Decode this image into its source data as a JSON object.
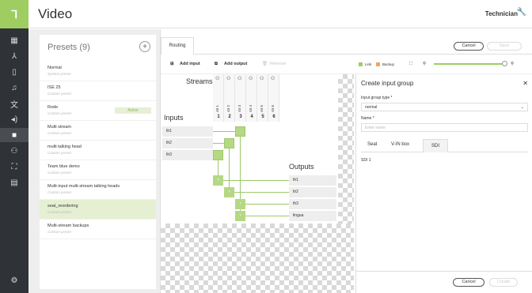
{
  "app": {
    "title": "Video",
    "user": "Technician"
  },
  "nav_icons": [
    "apps-icon",
    "network-icon",
    "device-icon",
    "audio-icon",
    "translate-icon",
    "speaker-icon",
    "video-icon",
    "users-icon",
    "seat-icon",
    "document-icon"
  ],
  "presets": {
    "title": "Presets (9)",
    "items": [
      {
        "name": "Normal",
        "sub": "System preset",
        "active": false
      },
      {
        "name": "ISE 25",
        "sub": "Custom preset",
        "active": false
      },
      {
        "name": "Rode",
        "sub": "Custom preset",
        "active": true,
        "badge": "Active"
      },
      {
        "name": "Multi stream",
        "sub": "Custom preset",
        "active": false
      },
      {
        "name": "multi talking head",
        "sub": "Custom preset",
        "active": false
      },
      {
        "name": "Team blue demo",
        "sub": "Custom preset",
        "active": false
      },
      {
        "name": "Multi-input multi-stream talking heads",
        "sub": "Custom preset",
        "active": false
      },
      {
        "name": "seat_reordering",
        "sub": "Custom preset",
        "active": false
      },
      {
        "name": "Multi-stream backups",
        "sub": "Custom preset",
        "active": false
      }
    ]
  },
  "routing": {
    "tab": "Routing",
    "cancel": "Cancel",
    "save": "Save",
    "toolbar": {
      "add_input": "Add input",
      "add_output": "Add output",
      "remove": "Remove",
      "link": "Link",
      "backup": "Backup"
    },
    "link_color": "#9fcd62",
    "backup_color": "#f2a65a",
    "streams_label": "Streams",
    "inputs_label": "Inputs",
    "outputs_label": "Outputs",
    "streams": [
      {
        "num": "1",
        "label": "str 1"
      },
      {
        "num": "2",
        "label": "str 2"
      },
      {
        "num": "3",
        "label": "str 3"
      },
      {
        "num": "4",
        "label": "str 4"
      },
      {
        "num": "5",
        "label": "str 5"
      },
      {
        "num": "6",
        "label": "str 6"
      }
    ],
    "inputs": [
      "th1",
      "th2",
      "th3"
    ],
    "outputs": [
      "th1",
      "th2",
      "th3",
      "lingua"
    ]
  },
  "panel": {
    "title": "Create input group",
    "type_label": "Input group type *",
    "type_value": "normal",
    "name_label": "Name *",
    "name_placeholder": "Enter name",
    "tabs": [
      "Seat",
      "V-IN box",
      "SDI"
    ],
    "list": [
      "SDI 1"
    ],
    "cancel": "Cancel",
    "create": "Create"
  }
}
